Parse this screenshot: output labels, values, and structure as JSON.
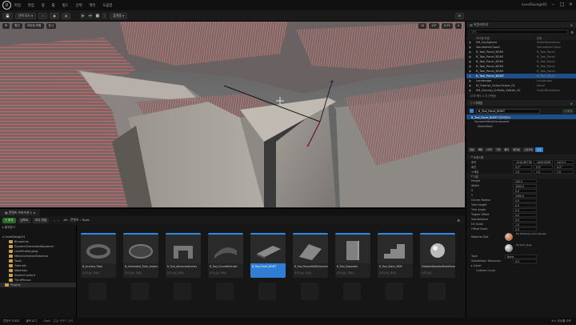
{
  "app": {
    "logo": "U",
    "menu": [
      "파일",
      "편집",
      "창",
      "툴",
      "빌드",
      "선택",
      "액터",
      "도움말"
    ],
    "window_title": "LevelSavage01"
  },
  "toolbar": {
    "save_label": "",
    "mode_label": "선택 모드",
    "platform_label": "플랫폼"
  },
  "viewport": {
    "perspective": "원근",
    "lit": "라이팅 포함",
    "show": "표시",
    "grid_value": "10",
    "angle_value": "10°",
    "scale_value": "0.25",
    "camera_value": "4"
  },
  "outliner": {
    "title": "아웃라이너",
    "search_placeholder": "검색...",
    "col_label": "아이템 라벨",
    "col_type": "유형",
    "rows": [
      {
        "label": "SM_SkySphere",
        "type": "StaticMeshActor",
        "sel": false
      },
      {
        "label": "VolumetricCloud",
        "type": "VolumetricCloud",
        "sel": false
      },
      {
        "label": "B_Tool_Panel_BGMI",
        "type": "B_Tool_Panel",
        "sel": false
      },
      {
        "label": "B_Tool_Panel_BGMI",
        "type": "B_Tool_Panel",
        "sel": false
      },
      {
        "label": "B_Tool_Panel_BGMI",
        "type": "B_Tool_Panel",
        "sel": false
      },
      {
        "label": "B_Tool_Panel_BGMI",
        "type": "B_Tool_Panel",
        "sel": false
      },
      {
        "label": "B_Tool_Panel_BGMI",
        "type": "B_Tool_Panel",
        "sel": false
      },
      {
        "label": "B_Tool_Panel_BGMT",
        "type": "B_Tool_Panel",
        "sel": true
      },
      {
        "label": "Landscape",
        "type": "Landscape",
        "sel": false
      },
      {
        "label": "M_Tutorial_ColourScene_01",
        "type": "Decal",
        "sel": false
      },
      {
        "label": "SM_Dummy_Infinite_Settler_01",
        "type": "StaticMeshActor",
        "sel": false
      }
    ],
    "count_label": "13개 액터 (1개 선택됨)"
  },
  "details": {
    "title": "디테일",
    "actor_name": "B_Tool_Panel_BGMT",
    "add_label": "+ 추가",
    "component_root": "B_Tool_Panel_BGMT (인스턴스)",
    "component_child": "DynamicMeshComponent",
    "component_mesh": "StaticMesh",
    "filter_tabs": [
      "일반",
      "액터",
      "LOD",
      "기타",
      "물리",
      "렌더링",
      "스트리밍",
      "모두"
    ],
    "transform_title": "트랜스폼",
    "location_label": "위치",
    "location": [
      "-1510.66778",
      "-1009.6285",
      "1413.3"
    ],
    "rotation_label": "회전",
    "rotation": [
      "0.0°",
      "0.0°",
      "0.0°"
    ],
    "scale_label": "스케일",
    "scale": [
      "1.0",
      "1.0",
      "1.0"
    ],
    "params_title": "기본",
    "params": [
      {
        "label": "Height",
        "value": "200.0"
      },
      {
        "label": "Width",
        "value": "1000.0"
      },
      {
        "label": "X",
        "value": "0.0"
      },
      {
        "label": "Y",
        "value": "1000.0"
      },
      {
        "label": "Corner Radius",
        "value": "0.0"
      },
      {
        "label": "Trim Height",
        "value": "0.0"
      },
      {
        "label": "Trim Angle",
        "value": "0.0"
      },
      {
        "label": "Trapez Offset",
        "value": "0.0"
      },
      {
        "label": "Subdivisions",
        "value": "0.0"
      },
      {
        "label": "UV Scale",
        "value": "1.0"
      },
      {
        "label": "Offset Scale",
        "value": "0.0"
      }
    ],
    "material_label": "Material Slot",
    "material_a": "MI_Default_Lumin_Rough",
    "material_b": "MI_Grid_Gray",
    "collision_label": "Type",
    "collision_value": "None",
    "subdiv_label": "Subdivision Tolerance",
    "subdiv_value": "0.0",
    "cover_label": "Cover",
    "custom_label": "Custom Curve"
  },
  "content_browser": {
    "tab": "콘텐츠 브라우저 1",
    "add_label": "+ 추가",
    "import_label": "임포트",
    "save_label": "모두 저장",
    "breadcrumb": [
      "All",
      "콘텐츠",
      "Tools"
    ],
    "favorites": "즐겨찾기",
    "project": "LevelDesign01",
    "folders": [
      {
        "label": "Blueprints",
        "depth": 1,
        "sel": false
      },
      {
        "label": "DynamicGeneratedSpawner",
        "depth": 1,
        "sel": false
      },
      {
        "label": "LevelPrototyping",
        "depth": 1,
        "sel": false
      },
      {
        "label": "MeshAnimationDiorama",
        "depth": 1,
        "sel": false
      },
      {
        "label": "Tools",
        "depth": 1,
        "sel": false
      },
      {
        "label": "Tutorials",
        "depth": 1,
        "sel": false
      },
      {
        "label": "Materials",
        "depth": 1,
        "sel": false
      },
      {
        "label": "StarterContent",
        "depth": 1,
        "sel": false
      },
      {
        "label": "ThirdPerson",
        "depth": 1,
        "sel": false
      },
      {
        "label": "Plugins",
        "depth": 0,
        "sel": true
      }
    ],
    "collections": "컬렉션",
    "item_count": "38개 아이템 (1개 선택됨)",
    "assets": [
      {
        "name": "B_Annulus_Tube",
        "kind": "블루프린트 클래스",
        "sel": false,
        "shape": "ring"
      },
      {
        "name": "B_Generated_Tube_Advanced",
        "kind": "블루프린트 클래스",
        "sel": false,
        "shape": "ring2"
      },
      {
        "name": "B_Tool_AdvancedArches",
        "kind": "블루프린트 클래스",
        "sel": false,
        "shape": "arch"
      },
      {
        "name": "B_Tool_CurvedExtrude",
        "kind": "블루프린트 클래스",
        "sel": false,
        "shape": "curve"
      },
      {
        "name": "B_Tool_Panel_BGMT",
        "kind": "블루프린트 클래스",
        "sel": true,
        "shape": "panel"
      },
      {
        "name": "B_Tool_RampWidthDynamic",
        "kind": "블루프린트 클래스",
        "sel": false,
        "shape": "ramp"
      },
      {
        "name": "B_Tool_Separator",
        "kind": "블루프린트 클래스",
        "sel": false,
        "shape": "sep"
      },
      {
        "name": "B_Tool_Stairs_BGM",
        "kind": "블루프린트 클래스",
        "sel": false,
        "shape": "stairs"
      },
      {
        "name": "EditableRotationModeParam",
        "kind": "블루프린트",
        "sel": false,
        "shape": "sphere"
      }
    ]
  },
  "status": {
    "content_drawer": "콘텐츠 드로어",
    "output_log": "출력 로그",
    "cmd": "Cmd",
    "cmd_placeholder": "콘솔 커맨드 입력",
    "source_control": "소스 컨트롤 오프"
  }
}
